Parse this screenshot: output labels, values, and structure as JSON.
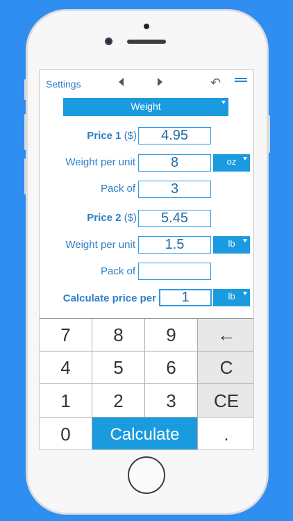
{
  "topbar": {
    "settings_label": "Settings",
    "prev_icon": "arrow-left",
    "next_icon": "arrow-right",
    "undo_icon": "undo",
    "menu_icon": "hamburger"
  },
  "mode_select": {
    "value": "Weight"
  },
  "form": {
    "price1": {
      "label_bold": "Price 1",
      "label_unit": "($)",
      "value": "4.95"
    },
    "weight1": {
      "label": "Weight per unit",
      "value": "8",
      "unit": "oz"
    },
    "pack1": {
      "label": "Pack of",
      "value": "3"
    },
    "price2": {
      "label_bold": "Price 2",
      "label_unit": "($)",
      "value": "5.45"
    },
    "weight2": {
      "label": "Weight per unit",
      "value": "1.5",
      "unit": "lb"
    },
    "pack2": {
      "label": "Pack of",
      "value": ""
    },
    "calc_per": {
      "label": "Calculate price per",
      "value": "1",
      "unit": "lb"
    }
  },
  "keypad": {
    "k7": "7",
    "k8": "8",
    "k9": "9",
    "back": "←",
    "k4": "4",
    "k5": "5",
    "k6": "6",
    "clear": "C",
    "k1": "1",
    "k2": "2",
    "k3": "3",
    "clear_entry": "CE",
    "k0": "0",
    "calculate": "Calculate",
    "dot": "."
  },
  "colors": {
    "accent": "#1a9be0",
    "label": "#2e7fc6",
    "background": "#2f8ef0"
  }
}
